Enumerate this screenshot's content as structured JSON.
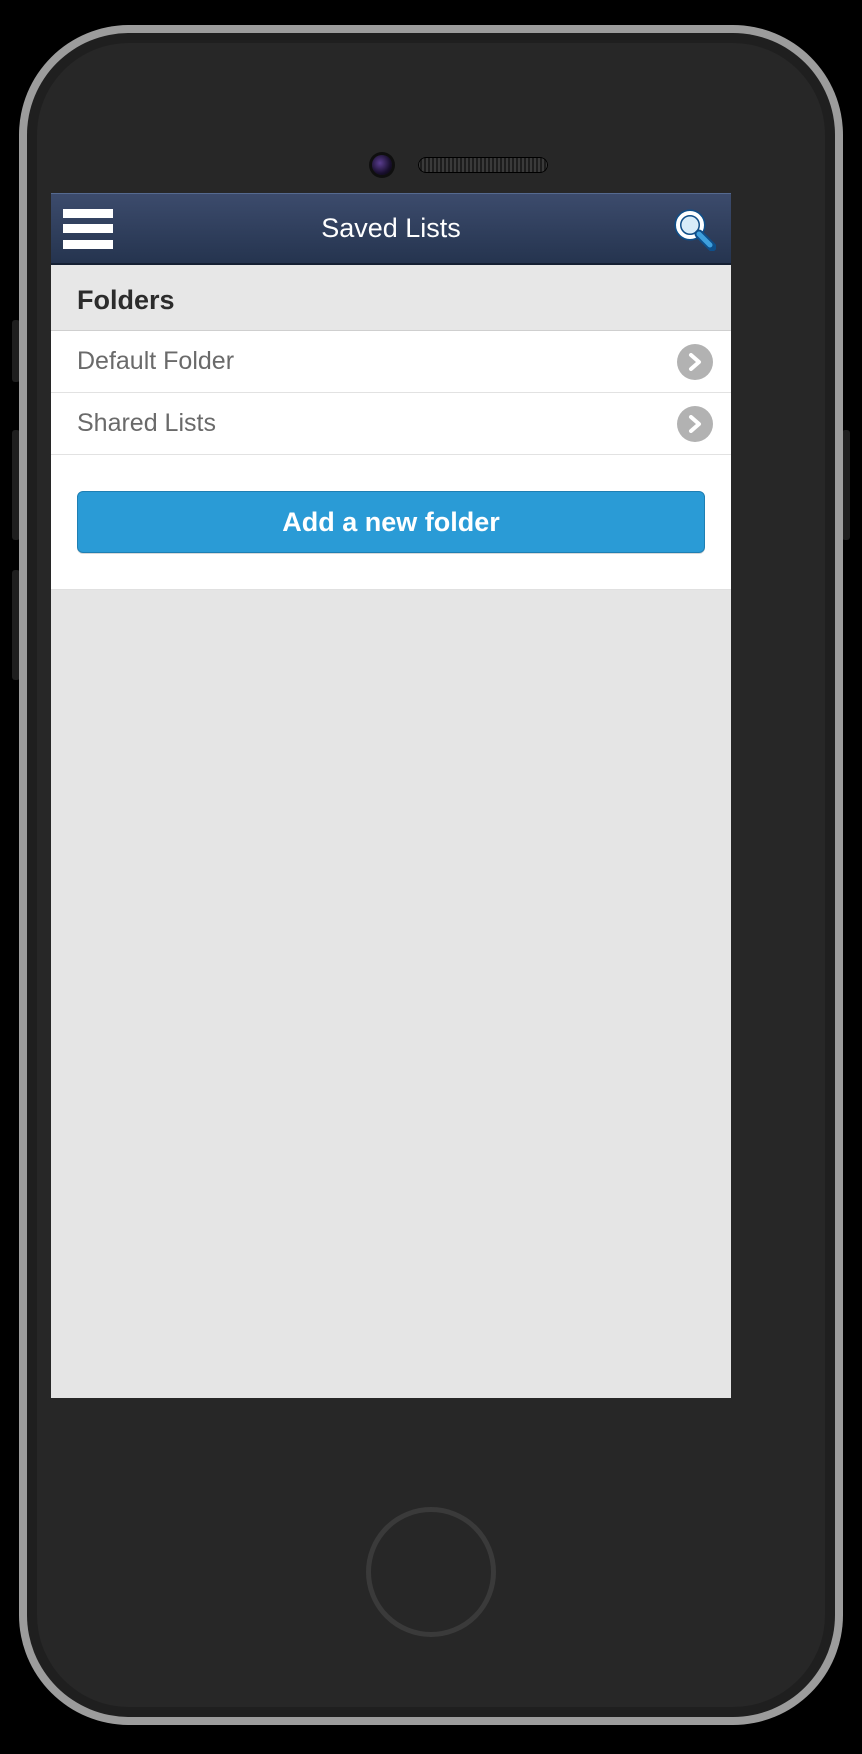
{
  "header": {
    "title": "Saved Lists"
  },
  "section": {
    "heading": "Folders"
  },
  "folders": [
    {
      "label": "Default Folder"
    },
    {
      "label": "Shared Lists"
    }
  ],
  "actions": {
    "add_folder_label": "Add a new folder"
  }
}
